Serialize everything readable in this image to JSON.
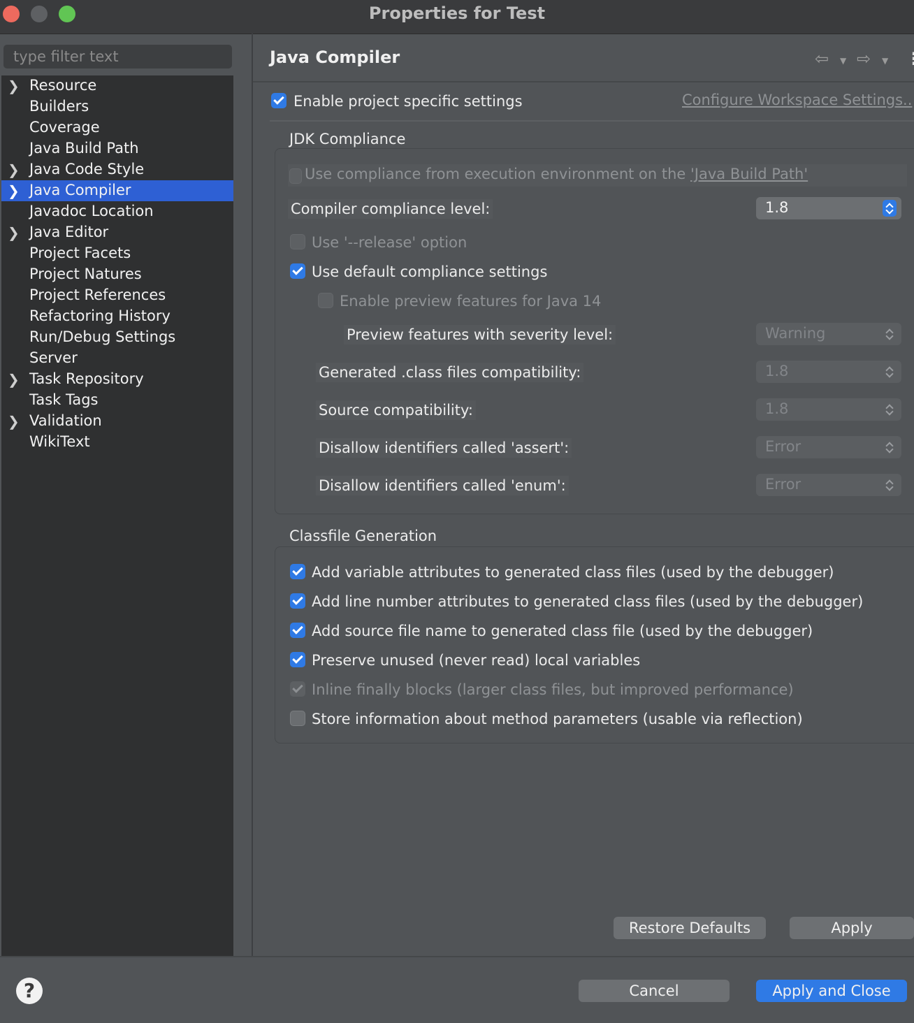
{
  "window": {
    "title": "Properties for Test"
  },
  "sidebar": {
    "filter_placeholder": "type filter text",
    "items": [
      {
        "label": "Resource",
        "expandable": true
      },
      {
        "label": "Builders",
        "expandable": false
      },
      {
        "label": "Coverage",
        "expandable": false
      },
      {
        "label": "Java Build Path",
        "expandable": false
      },
      {
        "label": "Java Code Style",
        "expandable": true
      },
      {
        "label": "Java Compiler",
        "expandable": true,
        "selected": true
      },
      {
        "label": "Javadoc Location",
        "expandable": false
      },
      {
        "label": "Java Editor",
        "expandable": true
      },
      {
        "label": "Project Facets",
        "expandable": false
      },
      {
        "label": "Project Natures",
        "expandable": false
      },
      {
        "label": "Project References",
        "expandable": false
      },
      {
        "label": "Refactoring History",
        "expandable": false
      },
      {
        "label": "Run/Debug Settings",
        "expandable": false
      },
      {
        "label": "Server",
        "expandable": false
      },
      {
        "label": "Task Repository",
        "expandable": true
      },
      {
        "label": "Task Tags",
        "expandable": false
      },
      {
        "label": "Validation",
        "expandable": true
      },
      {
        "label": "WikiText",
        "expandable": false
      }
    ]
  },
  "page": {
    "title": "Java Compiler",
    "enable_project_specific": "Enable project specific settings",
    "configure_workspace_link": "Configure Workspace Settings..",
    "jdk": {
      "group_title": "JDK Compliance",
      "use_exec_env_prefix": "Use compliance from execution environment on the ",
      "use_exec_env_link": "'Java Build Path'",
      "compliance_level_label": "Compiler compliance level:",
      "compliance_level_value": "1.8",
      "release_option": "Use '--release' option",
      "use_default": "Use default compliance settings",
      "enable_preview": "Enable preview features for Java 14",
      "preview_severity_label": "Preview features with severity level:",
      "preview_severity_value": "Warning",
      "class_compat_label": "Generated .class files compatibility:",
      "class_compat_value": "1.8",
      "source_compat_label": "Source compatibility:",
      "source_compat_value": "1.8",
      "assert_label": "Disallow identifiers called 'assert':",
      "assert_value": "Error",
      "enum_label": "Disallow identifiers called 'enum':",
      "enum_value": "Error"
    },
    "classfile": {
      "group_title": "Classfile Generation",
      "items": [
        "Add variable attributes to generated class files (used by the debugger)",
        "Add line number attributes to generated class files (used by the debugger)",
        "Add source file name to generated class file (used by the debugger)",
        "Preserve unused (never read) local variables",
        "Inline finally blocks (larger class files, but improved performance)",
        "Store information about method parameters (usable via reflection)"
      ]
    },
    "restore_defaults": "Restore Defaults",
    "apply": "Apply"
  },
  "footer": {
    "help": "?",
    "cancel": "Cancel",
    "apply_and_close": "Apply and Close"
  },
  "colors": {
    "accent": "#2f7ae5",
    "selection": "#2e60d4",
    "window_bg": "#515457",
    "sidebar_bg": "#2f3031"
  }
}
